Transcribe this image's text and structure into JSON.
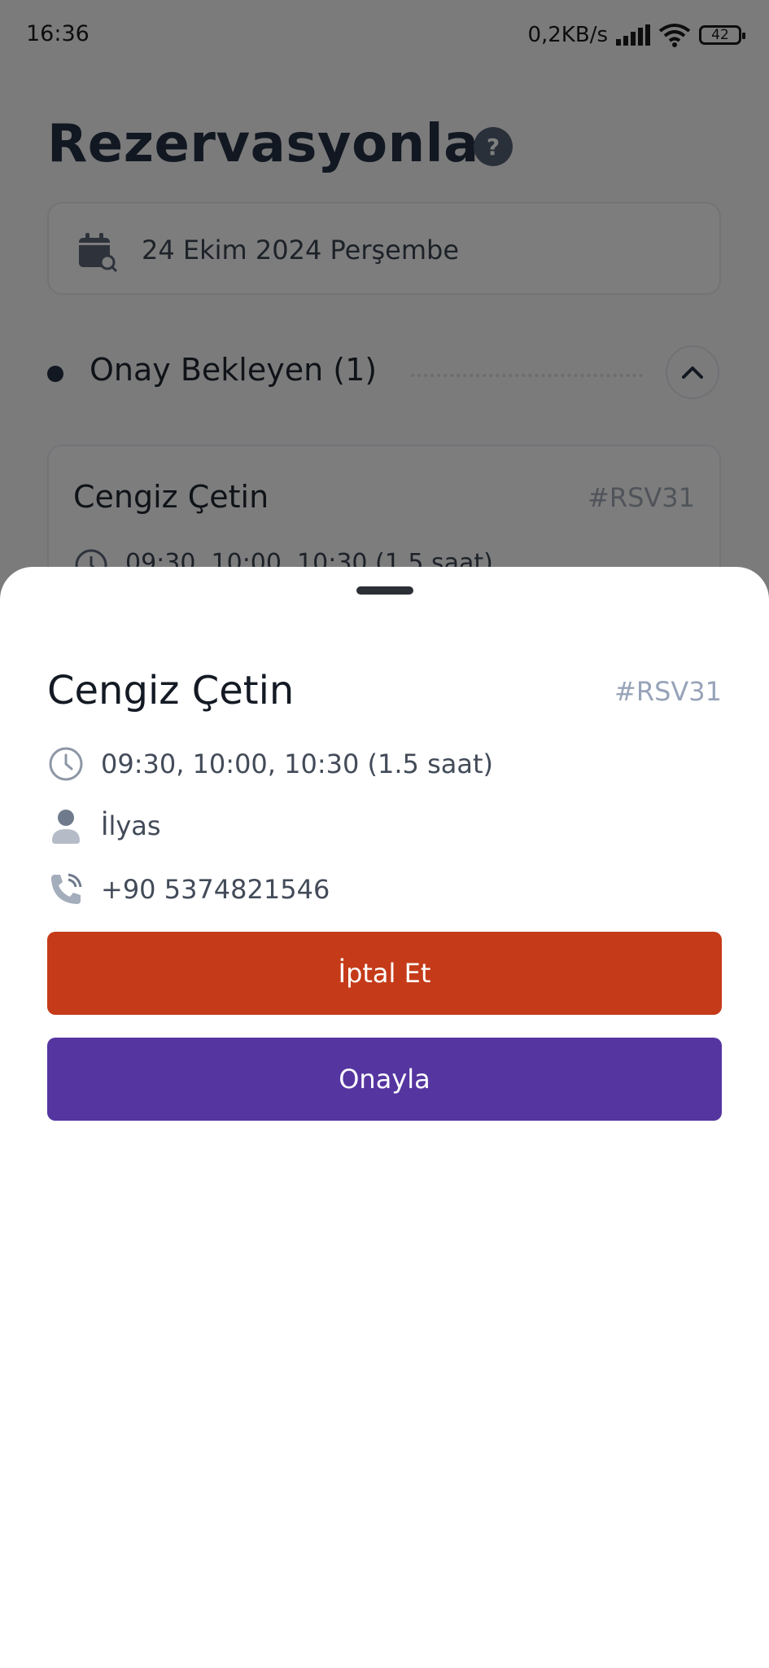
{
  "status_bar": {
    "time": "16:36",
    "network_speed": "0,2KB/s",
    "battery": "42"
  },
  "page": {
    "title": "Rezervasyonlar",
    "help_label": "?"
  },
  "date_picker": {
    "value": "24 Ekim 2024 Perşembe",
    "icon": "calendar-search-icon"
  },
  "section": {
    "title": "Onay Bekleyen (1)"
  },
  "background_card": {
    "name": "Cengiz Çetin",
    "id": "#RSV31",
    "time": "09:30, 10:00, 10:30 (1.5 saat)"
  },
  "sheet": {
    "name": "Cengiz Çetin",
    "id": "#RSV31",
    "time": "09:30, 10:00, 10:30 (1.5 saat)",
    "person": "İlyas",
    "phone": "+90 5374821546",
    "cancel_label": "İptal Et",
    "approve_label": "Onayla"
  },
  "colors": {
    "cancel": "#c53b19",
    "approve": "#5535a0",
    "overlay": "rgba(0,0,0,0.5)"
  }
}
